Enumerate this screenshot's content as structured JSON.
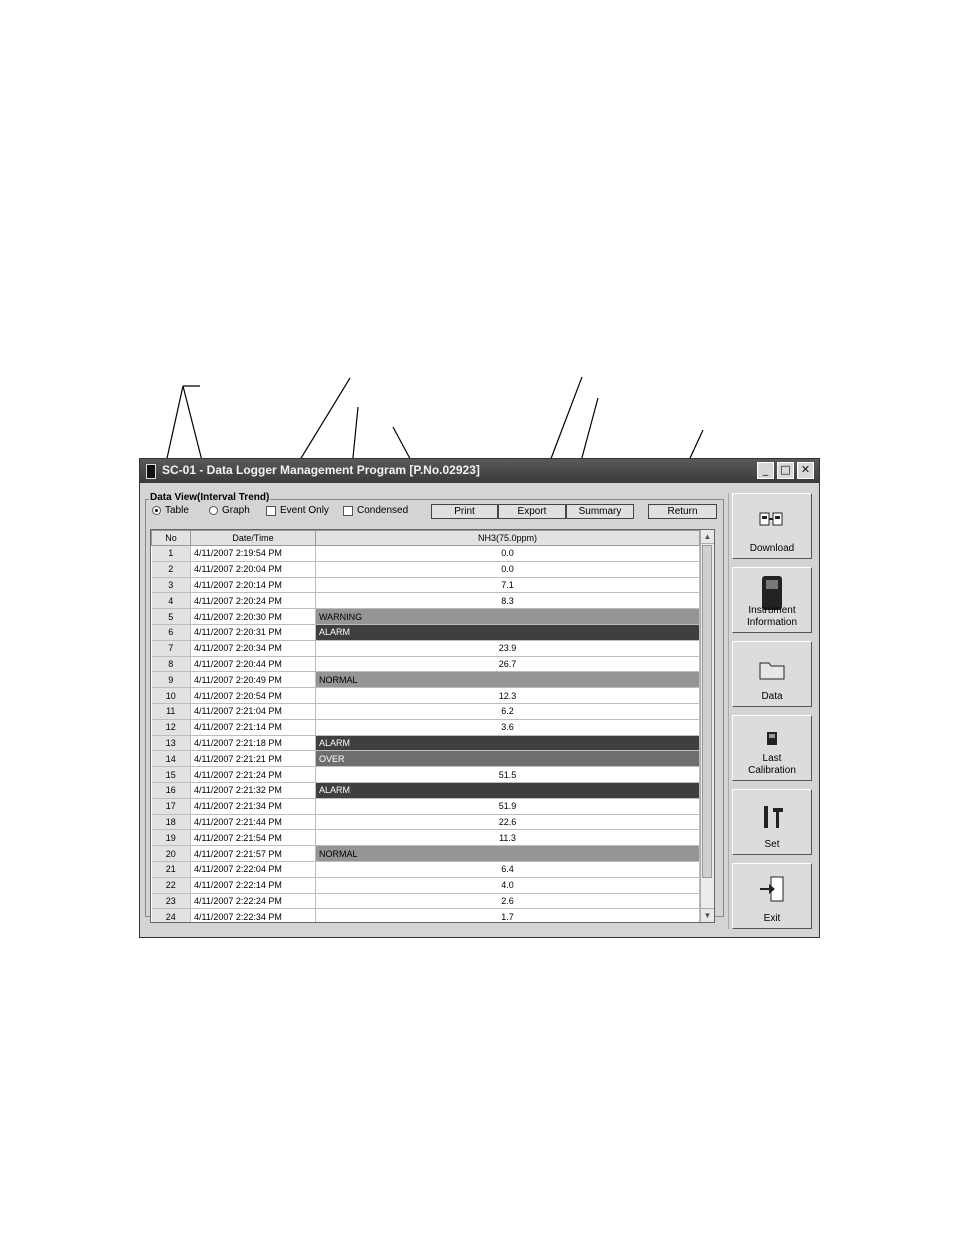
{
  "window": {
    "title": "SC-01 - Data Logger Management Program [P.No.02923]",
    "buttons": {
      "minimize": "_",
      "maximize": "□",
      "close": "✕"
    }
  },
  "view": {
    "group_label": "Data View(Interval Trend)",
    "radio_table": "Table",
    "radio_graph": "Graph",
    "selected": "Table",
    "check_event_only": "Event Only",
    "check_condensed": "Condensed",
    "print": "Print",
    "export": "Export",
    "summary": "Summary",
    "return": "Return"
  },
  "table": {
    "headers": [
      "No",
      "Date/Time",
      "NH3(75.0ppm)"
    ],
    "rows": [
      {
        "no": "1",
        "datetime": "4/11/2007 2:19:54 PM",
        "value": "0.0"
      },
      {
        "no": "2",
        "datetime": "4/11/2007 2:20:04 PM",
        "value": "0.0"
      },
      {
        "no": "3",
        "datetime": "4/11/2007 2:20:14 PM",
        "value": "7.1"
      },
      {
        "no": "4",
        "datetime": "4/11/2007 2:20:24 PM",
        "value": "8.3"
      },
      {
        "no": "5",
        "datetime": "4/11/2007 2:20:30 PM",
        "event": "WARNING"
      },
      {
        "no": "6",
        "datetime": "4/11/2007 2:20:31 PM",
        "event": "ALARM"
      },
      {
        "no": "7",
        "datetime": "4/11/2007 2:20:34 PM",
        "value": "23.9"
      },
      {
        "no": "8",
        "datetime": "4/11/2007 2:20:44 PM",
        "value": "26.7"
      },
      {
        "no": "9",
        "datetime": "4/11/2007 2:20:49 PM",
        "event": "NORMAL"
      },
      {
        "no": "10",
        "datetime": "4/11/2007 2:20:54 PM",
        "value": "12.3"
      },
      {
        "no": "11",
        "datetime": "4/11/2007 2:21:04 PM",
        "value": "6.2"
      },
      {
        "no": "12",
        "datetime": "4/11/2007 2:21:14 PM",
        "value": "3.6"
      },
      {
        "no": "13",
        "datetime": "4/11/2007 2:21:18 PM",
        "event": "ALARM"
      },
      {
        "no": "14",
        "datetime": "4/11/2007 2:21:21 PM",
        "event": "OVER"
      },
      {
        "no": "15",
        "datetime": "4/11/2007 2:21:24 PM",
        "value": "51.5"
      },
      {
        "no": "16",
        "datetime": "4/11/2007 2:21:32 PM",
        "event": "ALARM"
      },
      {
        "no": "17",
        "datetime": "4/11/2007 2:21:34 PM",
        "value": "51.9"
      },
      {
        "no": "18",
        "datetime": "4/11/2007 2:21:44 PM",
        "value": "22.6"
      },
      {
        "no": "19",
        "datetime": "4/11/2007 2:21:54 PM",
        "value": "11.3"
      },
      {
        "no": "20",
        "datetime": "4/11/2007 2:21:57 PM",
        "event": "NORMAL"
      },
      {
        "no": "21",
        "datetime": "4/11/2007 2:22:04 PM",
        "value": "6.4"
      },
      {
        "no": "22",
        "datetime": "4/11/2007 2:22:14 PM",
        "value": "4.0"
      },
      {
        "no": "23",
        "datetime": "4/11/2007 2:22:24 PM",
        "value": "2.6"
      },
      {
        "no": "24",
        "datetime": "4/11/2007 2:22:34 PM",
        "value": "1.7"
      }
    ],
    "event_colors": {
      "WARNING": "#959595",
      "NORMAL": "#959595",
      "ALARM": "#3f3f3f",
      "OVER": "#6e6e6e"
    }
  },
  "sidebar": {
    "download": "Download",
    "instrument_1": "Instrument",
    "instrument_2": "Information",
    "data": "Data",
    "calibration_1": "Last",
    "calibration_2": "Calibration",
    "set": "Set",
    "exit": "Exit"
  },
  "icons": [
    "download-icon",
    "instrument-icon",
    "folder-icon",
    "calibration-icon",
    "tools-icon",
    "exit-icon"
  ]
}
